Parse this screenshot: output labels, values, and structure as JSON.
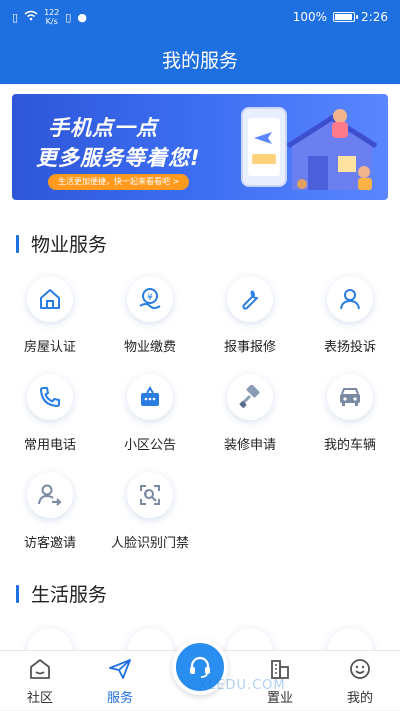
{
  "status_bar": {
    "speed_top": "122",
    "speed_unit": "K/s",
    "battery": "100%",
    "battery_level": 1.0,
    "time": "2:26"
  },
  "header": {
    "title": "我的服务"
  },
  "banner": {
    "line1": "手机点一点",
    "line2": "更多服务等着您!",
    "pill": "生活更加便捷，快一起来看看吧 >"
  },
  "property_section": {
    "title": "物业服务",
    "items": [
      {
        "label": "房屋认证",
        "icon": "house-icon"
      },
      {
        "label": "物业缴费",
        "icon": "payment-icon"
      },
      {
        "label": "报事报修",
        "icon": "wrench-icon"
      },
      {
        "label": "表扬投诉",
        "icon": "person-icon"
      },
      {
        "label": "常用电话",
        "icon": "phone-icon"
      },
      {
        "label": "小区公告",
        "icon": "notice-icon"
      },
      {
        "label": "装修申请",
        "icon": "paint-roller-icon"
      },
      {
        "label": "我的车辆",
        "icon": "car-icon"
      },
      {
        "label": "访客邀请",
        "icon": "visitor-icon"
      },
      {
        "label": "人脸识别门禁",
        "icon": "face-id-icon"
      }
    ]
  },
  "life_section": {
    "title": "生活服务"
  },
  "tabbar": {
    "items": [
      {
        "label": "社区",
        "icon": "community-icon"
      },
      {
        "label": "服务",
        "icon": "paper-plane-icon",
        "active": true
      },
      {
        "label": "",
        "icon": "headset-icon"
      },
      {
        "label": "置业",
        "icon": "buildings-icon"
      },
      {
        "label": "我的",
        "icon": "smiley-icon"
      }
    ]
  },
  "watermark": "CXLEDU.COM",
  "colors": {
    "primary": "#1e6fe0",
    "accent": "#ff9a1f",
    "icon_blue": "#2a7de1"
  }
}
